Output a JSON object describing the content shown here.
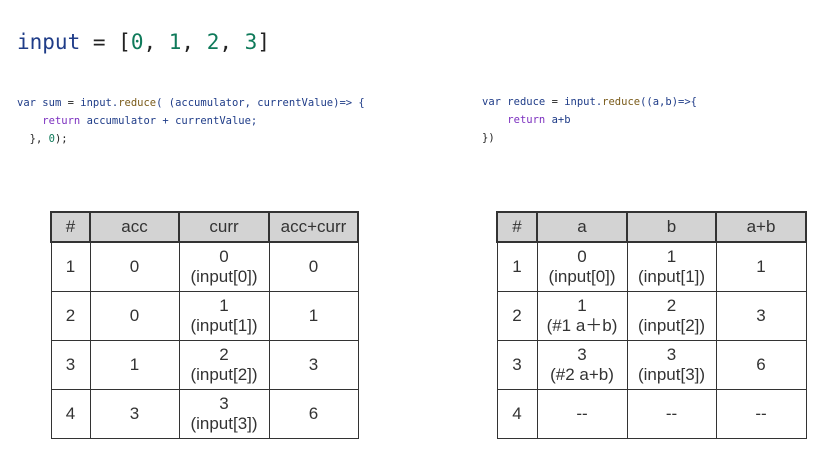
{
  "headline": {
    "var": "input",
    "eq": " = ",
    "open": "[",
    "values": [
      "0",
      "1",
      "2",
      "3"
    ],
    "close": "]"
  },
  "code_left": [
    [
      "var",
      "sum",
      "=",
      "input.",
      "reduce",
      "( (accumulator, currentValue)=> {"
    ],
    [
      "return",
      "accumulator + currentValue;"
    ],
    [
      "},",
      "0",
      ");"
    ]
  ],
  "code_right": [
    [
      "var",
      "reduce",
      "=",
      "input.",
      "reduce",
      "((a,b)=>{"
    ],
    [
      "return",
      "a+b"
    ],
    [
      "})"
    ]
  ],
  "table_left": {
    "headers": [
      "#",
      "acc",
      "curr",
      "acc+curr"
    ],
    "rows": [
      {
        "n": "1",
        "acc": "0",
        "curr": "0",
        "curr_src": "(input[0])",
        "sum": "0"
      },
      {
        "n": "2",
        "acc": "0",
        "curr": "1",
        "curr_src": "(input[1])",
        "sum": "1"
      },
      {
        "n": "3",
        "acc": "1",
        "curr": "2",
        "curr_src": "(input[2])",
        "sum": "3"
      },
      {
        "n": "4",
        "acc": "3",
        "curr": "3",
        "curr_src": "(input[3])",
        "sum": "6"
      }
    ]
  },
  "table_right": {
    "headers": [
      "#",
      "a",
      "b",
      "a+b"
    ],
    "rows": [
      {
        "n": "1",
        "a": "0",
        "a_src": "(input[0])",
        "b": "1",
        "b_src": "(input[1])",
        "sum": "1"
      },
      {
        "n": "2",
        "a": "1",
        "a_src": "(#1 a＋b)",
        "b": "2",
        "b_src": "(input[2])",
        "sum": "3"
      },
      {
        "n": "3",
        "a": "3",
        "a_src": "(#2 a+b)",
        "b": "3",
        "b_src": "(input[3])",
        "sum": "6"
      },
      {
        "n": "4",
        "a": "--",
        "a_src": "",
        "b": "--",
        "b_src": "",
        "sum": "--"
      }
    ]
  }
}
